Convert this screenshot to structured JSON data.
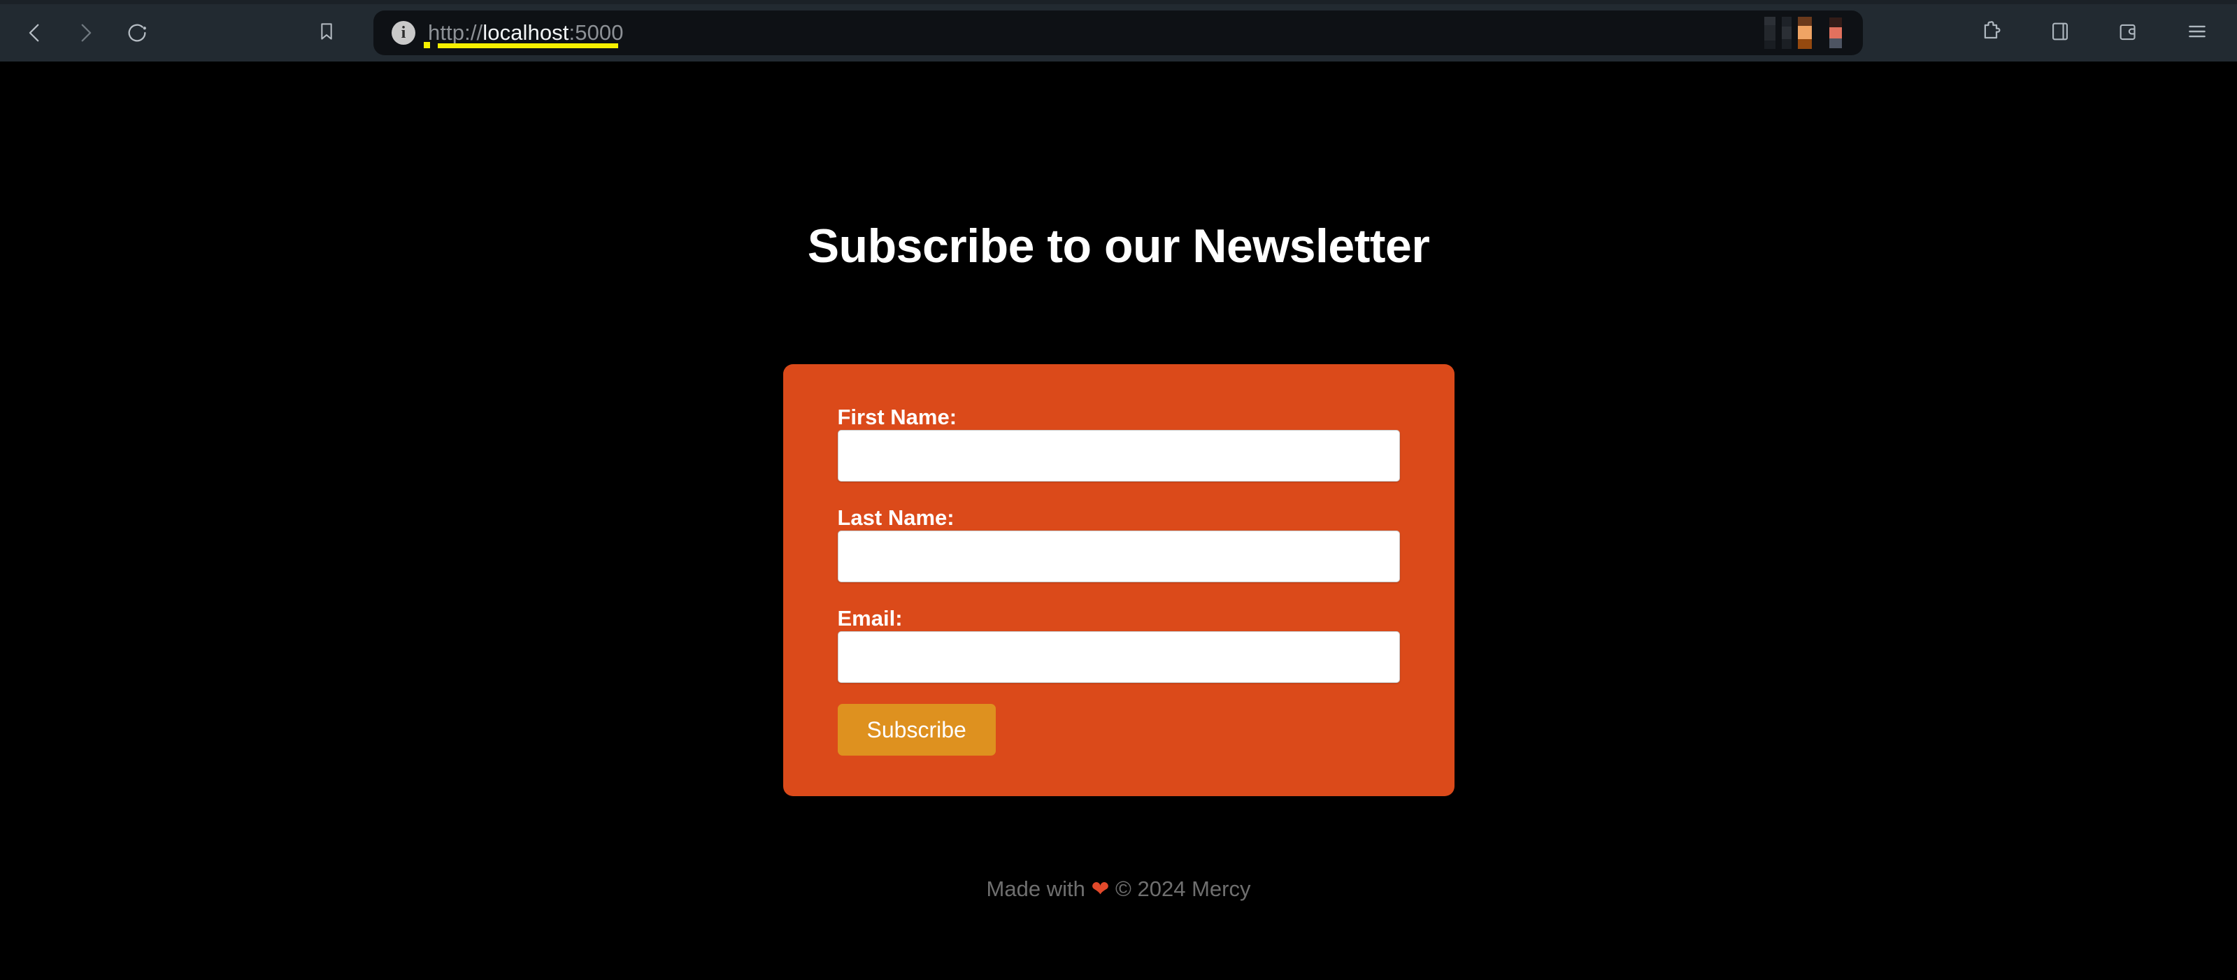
{
  "browser": {
    "back_label": "Back",
    "forward_label": "Forward",
    "reload_label": "Reload",
    "bookmark_label": "Bookmark this page",
    "url_scheme": "http://",
    "url_host": "localhost",
    "url_port": ":5000",
    "url_full": "http://localhost:5000",
    "security_label": "Site information",
    "extensions_label": "Extensions",
    "split_view_label": "Split view",
    "wallet_label": "Wallet",
    "menu_label": "Customize and control",
    "accent_highlight": "#f5f000",
    "chrome_bg": "#222a31",
    "urlbar_bg": "#0e1115"
  },
  "page": {
    "title": "Subscribe to our Newsletter",
    "background": "#000000",
    "card": {
      "background": "#DB4A1A",
      "fields": [
        {
          "label": "First Name:",
          "value": "",
          "placeholder": "",
          "name": "first-name"
        },
        {
          "label": "Last Name:",
          "value": "",
          "placeholder": "",
          "name": "last-name"
        },
        {
          "label": "Email:",
          "value": "",
          "placeholder": "",
          "name": "email"
        }
      ],
      "submit_label": "Subscribe",
      "submit_color": "#DE911F"
    },
    "footer": {
      "prefix": "Made with ",
      "heart": "❤",
      "suffix": " © 2024 Mercy",
      "text": "Made with ❤ © 2024 Mercy",
      "color": "#6f6f6f"
    }
  }
}
